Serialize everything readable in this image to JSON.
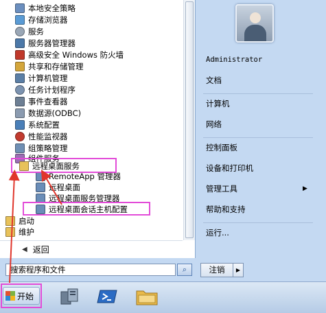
{
  "programs": [
    {
      "label": "本地安全策略",
      "icon": "security-policy-icon",
      "color": "#6b8fbf"
    },
    {
      "label": "存储浏览器",
      "icon": "storage-explorer-icon",
      "color": "#5a9bd5"
    },
    {
      "label": "服务",
      "icon": "services-gear-icon",
      "color": "#9aa7b6"
    },
    {
      "label": "服务器管理器",
      "icon": "server-manager-icon",
      "color": "#4c78a8"
    },
    {
      "label": "高级安全 Windows 防火墙",
      "icon": "firewall-icon",
      "color": "#c0392b"
    },
    {
      "label": "共享和存储管理",
      "icon": "share-storage-icon",
      "color": "#d4a63b"
    },
    {
      "label": "计算机管理",
      "icon": "computer-management-icon",
      "color": "#5b7fa6"
    },
    {
      "label": "任务计划程序",
      "icon": "task-scheduler-icon",
      "color": "#7c93b0"
    },
    {
      "label": "事件查看器",
      "icon": "event-viewer-icon",
      "color": "#6d7f94"
    },
    {
      "label": "数据源(ODBC)",
      "icon": "odbc-icon",
      "color": "#8b9bb0"
    },
    {
      "label": "系统配置",
      "icon": "system-config-icon",
      "color": "#4a7fb8"
    },
    {
      "label": "性能监视器",
      "icon": "performance-monitor-icon",
      "color": "#c23b2f"
    },
    {
      "label": "组策略管理",
      "icon": "group-policy-icon",
      "color": "#6f8fb4"
    },
    {
      "label": "组件服务",
      "icon": "component-services-icon",
      "color": "#9b6fb4"
    },
    {
      "label": "远程桌面服务",
      "icon": "folder-icon",
      "color": "#e8c25a"
    },
    {
      "label": "RemoteApp 管理器",
      "icon": "remoteapp-icon",
      "color": "#6a8db8"
    },
    {
      "label": "远程桌面",
      "icon": "remote-desktop-icon",
      "color": "#6a8db8"
    },
    {
      "label": "远程桌面服务管理器",
      "icon": "rds-manager-icon",
      "color": "#6a8db8"
    },
    {
      "label": "远程桌面会话主机配置",
      "icon": "session-host-config-icon",
      "color": "#6a8db8"
    },
    {
      "label": "启动",
      "icon": "folder-icon",
      "color": "#e8c25a"
    },
    {
      "label": "维护",
      "icon": "folder-icon",
      "color": "#e8c25a"
    }
  ],
  "back_label": "返回",
  "search": {
    "placeholder": "搜索程序和文件"
  },
  "right_items": [
    {
      "label": "Administrator"
    },
    {
      "label": "文档"
    },
    {
      "label": "计算机"
    },
    {
      "label": "网络"
    },
    {
      "label": "控制面板"
    },
    {
      "label": "设备和打印机"
    },
    {
      "label": "管理工具",
      "submenu": "▶"
    },
    {
      "label": "帮助和支持"
    },
    {
      "label": "运行..."
    }
  ],
  "logoff": {
    "label": "注销",
    "arrow": "▶"
  },
  "taskbar": {
    "start_label": "开始",
    "pinned": [
      "server-manager-icon",
      "powershell-icon",
      "explorer-folder-icon"
    ]
  },
  "annotation_color": "#e24bd8"
}
